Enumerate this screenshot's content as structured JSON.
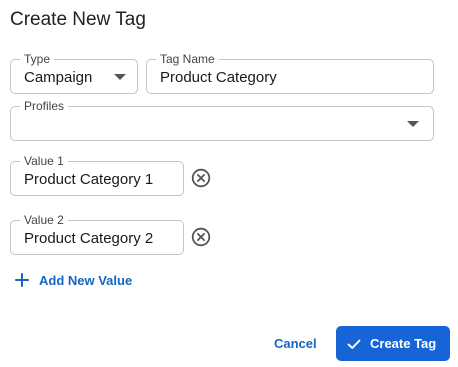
{
  "dialog": {
    "title": "Create New Tag"
  },
  "type_field": {
    "label": "Type",
    "value": "Campaign"
  },
  "tag_name_field": {
    "label": "Tag Name",
    "value": "Product Category"
  },
  "profiles_field": {
    "label": "Profiles",
    "value": ""
  },
  "values": [
    {
      "label": "Value 1",
      "value": "Product Category 1"
    },
    {
      "label": "Value 2",
      "value": "Product Category 2"
    }
  ],
  "add_value_label": "Add New Value",
  "actions": {
    "cancel_label": "Cancel",
    "create_label": "Create Tag"
  },
  "icons": {
    "dropdown": "chevron-down-icon",
    "remove": "close-circle-icon",
    "add": "plus-icon",
    "confirm": "check-icon"
  },
  "colors": {
    "primary": "#1565d8",
    "link": "#1565c0",
    "border": "#c4c4c4"
  }
}
